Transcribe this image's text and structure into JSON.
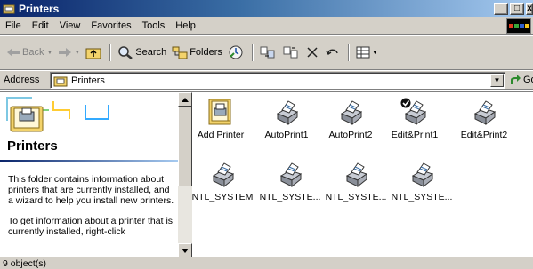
{
  "window": {
    "title": "Printers"
  },
  "menu": {
    "items": [
      "File",
      "Edit",
      "View",
      "Favorites",
      "Tools",
      "Help"
    ]
  },
  "toolbar": {
    "back": "Back",
    "search": "Search",
    "folders": "Folders"
  },
  "address": {
    "label": "Address",
    "value": "Printers",
    "go": "Go"
  },
  "leftpane": {
    "title": "Printers",
    "paragraphs": [
      "This folder contains information about printers that are currently installed, and a wizard to help you install new printers.",
      "To get information about a printer that is currently installed, right-click"
    ]
  },
  "items": [
    {
      "label": "Add Printer",
      "icon": "add-printer-icon"
    },
    {
      "label": "AutoPrint1",
      "icon": "printer-icon"
    },
    {
      "label": "AutoPrint2",
      "icon": "printer-icon"
    },
    {
      "label": "Edit&Print1",
      "icon": "default-printer-icon"
    },
    {
      "label": "Edit&Print2",
      "icon": "printer-icon"
    },
    {
      "label": "NTL_SYSTEM",
      "icon": "printer-icon"
    },
    {
      "label": "NTL_SYSTE...",
      "icon": "printer-icon"
    },
    {
      "label": "NTL_SYSTE...",
      "icon": "printer-icon"
    },
    {
      "label": "NTL_SYSTE...",
      "icon": "printer-icon"
    }
  ],
  "status": {
    "text": "9 object(s)"
  }
}
